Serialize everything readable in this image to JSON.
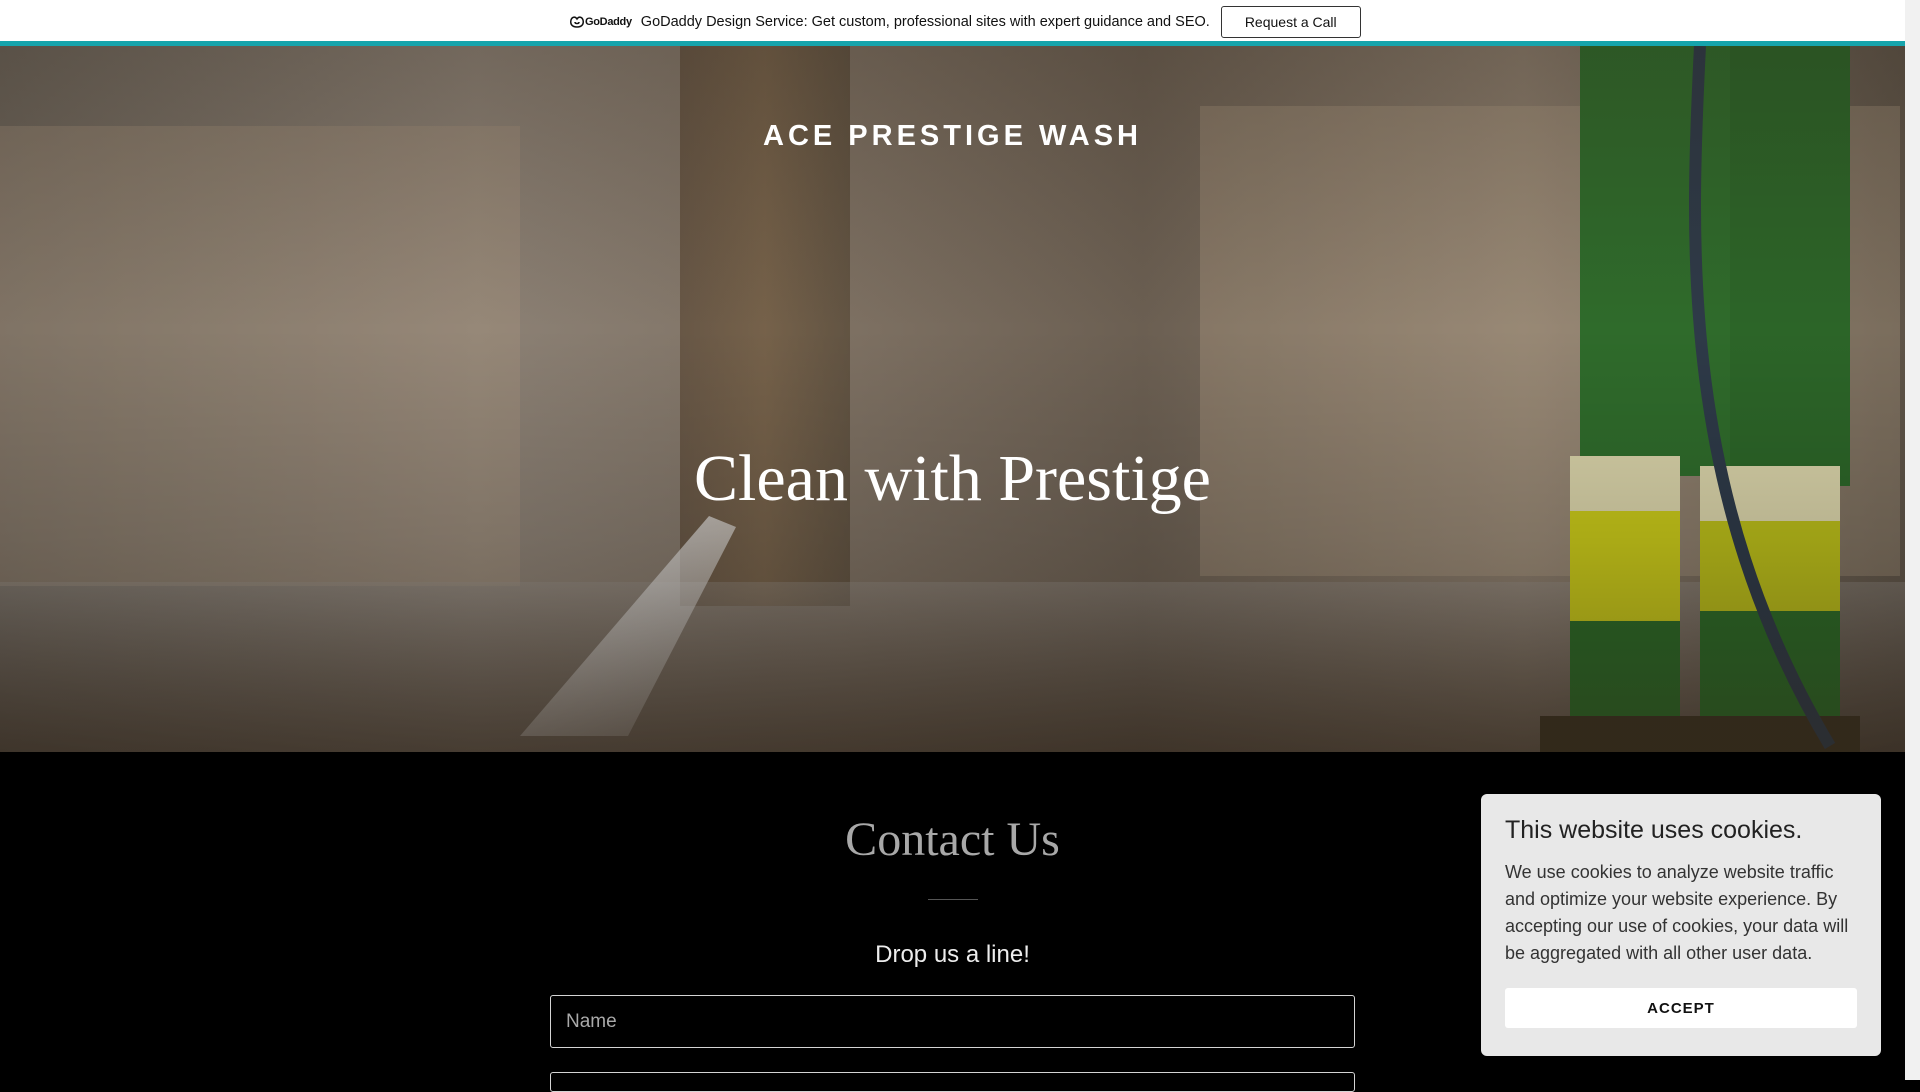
{
  "promo": {
    "logo_text": "GoDaddy",
    "message": "GoDaddy Design Service: Get custom, professional sites with expert guidance and SEO.",
    "cta_label": "Request a Call",
    "accent_color": "#16a4ac"
  },
  "hero": {
    "site_title": "ACE PRESTIGE WASH",
    "headline": "Clean with Prestige"
  },
  "contact": {
    "title": "Contact Us",
    "subtitle": "Drop us a line!",
    "name_placeholder": "Name"
  },
  "cookie": {
    "title": "This website uses cookies.",
    "body": "We use cookies to analyze website traffic and optimize your website experience. By accepting our use of cookies, your data will be aggregated with all other user data.",
    "accept_label": "ACCEPT"
  }
}
